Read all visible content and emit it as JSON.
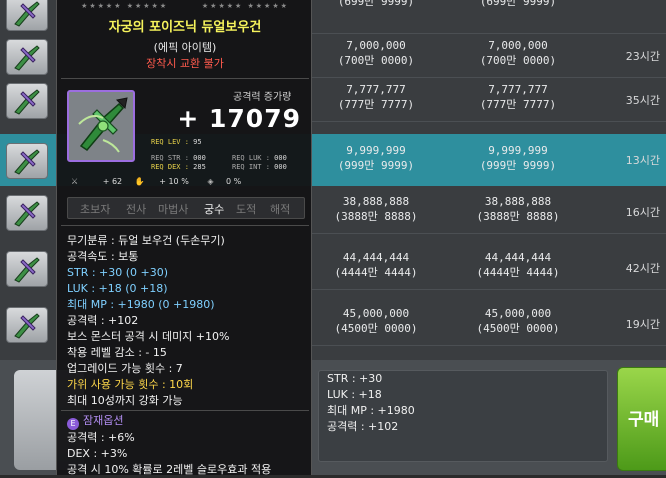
{
  "rows": [
    {
      "price_a": "(699만 9999)",
      "price_b": "(699만 9999)",
      "time": ""
    },
    {
      "price_a": "7,000,000\n(700만 0000)",
      "price_b": "7,000,000\n(700만 0000)",
      "time": "23시간"
    },
    {
      "price_a": "7,777,777\n(777만 7777)",
      "price_b": "7,777,777\n(777만 7777)",
      "time": "35시간"
    },
    {
      "price_a": "9,999,999\n(999만 9999)",
      "price_b": "9,999,999\n(999만 9999)",
      "time": "13시간"
    },
    {
      "price_a": "38,888,888\n(3888만 8888)",
      "price_b": "38,888,888\n(3888만 8888)",
      "time": "16시간"
    },
    {
      "price_a": "44,444,444\n(4444만 4444)",
      "price_b": "44,444,444\n(4444만 4444)",
      "time": "42시간"
    },
    {
      "price_a": "45,000,000\n(4500만 0000)",
      "price_b": "45,000,000\n(4500만 0000)",
      "time": "19시간"
    }
  ],
  "selected_row": 3,
  "tooltip": {
    "item_name": "자궁의 포이즈닉 듀얼보우건",
    "grade": "(에픽 아이템)",
    "trade_note": "장착시 교환 불가",
    "attack_label": "공격력 증가량",
    "attack_value": "+ 17079",
    "req": {
      "lev_label": "REQ LEV :",
      "lev": "95",
      "str_label": "REQ STR :",
      "str": "000",
      "luk_label": "REQ LUK :",
      "luk": "000",
      "dex_label": "REQ DEX :",
      "dex": "285",
      "int_label": "REQ INT :",
      "int": "000"
    },
    "mini": {
      "a": "+ 62",
      "b": "+ 10 %",
      "c": "0 %"
    },
    "jobs": [
      "초보자",
      "전사",
      "마법사",
      "궁수",
      "도적",
      "해적"
    ],
    "active_job_index": 3,
    "desc": [
      "무기분류 : 듀얼 보우건 (두손무기)",
      "공격속도 : 보통",
      "STR : +30 (0 +30)",
      "LUK : +18 (0 +18)",
      "최대 MP : +1980 (0 +1980)",
      "공격력 : +102",
      "보스 몬스터 공격 시 데미지 +10%",
      "착용 레벨 감소 : - 15",
      "업그레이드 가능 횟수 : 7",
      "가위 사용 가능 횟수 : 10회",
      "최대 10성까지 강화 가능"
    ],
    "potential_title": "잠재옵션",
    "potential_icon": "E",
    "potential": [
      "공격력 : +6%",
      "DEX : +3%",
      "공격 시 10% 확률로 2레벨 슬로우효과 적용"
    ]
  },
  "stats_panel": [
    "STR : +30",
    "LUK : +18",
    "최대 MP : +1980",
    "공격력 : +102"
  ],
  "buy_button": "구매",
  "colors": {
    "selected_row": "#2e8f9e",
    "item_name": "#f6f35c",
    "trade_note": "#ff5a4d",
    "epic_border": "#9c6ee0"
  }
}
